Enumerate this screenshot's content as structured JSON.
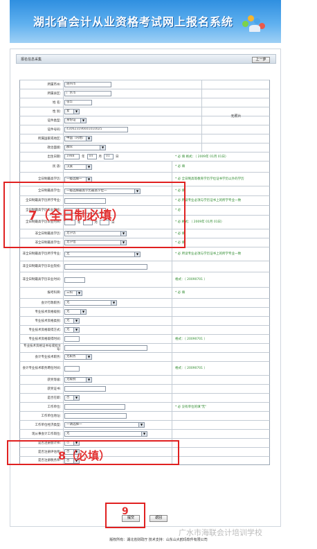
{
  "header": {
    "title": "湖北省会计从业资格考试网上报名系统"
  },
  "infobar": {
    "label": "报名信息采集",
    "back_button": "上一步"
  },
  "photo_label": "无照片",
  "form": {
    "rows": [
      {
        "label": "所属市州:",
        "value": "随州市"
      },
      {
        "label": "所属县区:",
        "value": "广水市"
      },
      {
        "label": "姓    名:",
        "value": "张华"
      },
      {
        "label": "性    别:",
        "value": "女"
      },
      {
        "label": "证件类型:",
        "value": "身份证"
      },
      {
        "label": "证件号码:",
        "value": "430623196601010025"
      },
      {
        "label": "所属国家或地区:",
        "value": "中国（内地）"
      },
      {
        "label": "政治面貌:",
        "value": "群众"
      },
      {
        "label": "出生日期:",
        "value": "1988",
        "month": "04",
        "day": "01",
        "year_unit": "年",
        "month_unit": "月",
        "day_unit": "日",
        "note": "* 必 填   格式：（ 2009年 01月 01日）"
      },
      {
        "label": "民    族:",
        "value": "汉族",
        "note": "* 必 填"
      },
      {
        "label": "全日制最高学历:",
        "value": "一级选择一",
        "note": "* 必    全日制高等教育学历学位证书学历以外的学历"
      },
      {
        "label": "全日制最高学位:",
        "value": "一级选择最高学历最高学位一",
        "note": "* 必 填"
      },
      {
        "label": "全日制最高学历所学专业:",
        "value": "",
        "note": "* 必    所读专业必须与学历证书上的所学专业一致"
      },
      {
        "label": "全日制最高学历毕业院校:",
        "value": "",
        "note": "* 必"
      },
      {
        "label": "全日制最高学历毕业时间:",
        "value": "",
        "year_unit": "年",
        "month_unit": "月",
        "day_unit": "日",
        "note": "* 必    格式：（ 2009年 01月 01日）"
      },
      {
        "label": "非全日制最高学历:",
        "value": "无学历",
        "note": "* 必 填"
      },
      {
        "label": "非全日制最高学位:",
        "value": "无学位",
        "note": "* 必 填"
      },
      {
        "label": "非全日制最高学历所学专业:",
        "value": "无",
        "note": "* 必    所读专业必须与学历证书上的所学专业一致"
      },
      {
        "label": "非全日制最高学历毕业院校:",
        "value": ""
      },
      {
        "label": "非全日制最高学历毕业时间:",
        "value": "",
        "note": "格式：（ 20090701 ）"
      },
      {
        "label": "报考科目:",
        "value": "三科",
        "note": "* 必 填"
      },
      {
        "label": "会计行政职务:",
        "value": "无"
      },
      {
        "label": "专业技术资格级别:",
        "value": "无"
      },
      {
        "label": "专业技术资格类别:",
        "value": "无"
      },
      {
        "label": "专业技术资格取得方式:",
        "value": "无"
      },
      {
        "label": "专业技术资格取得时间:",
        "value": "",
        "note": "格式：（ 20090701 ）"
      },
      {
        "label": "专业技术资格证书号或批文号:",
        "value": ""
      },
      {
        "label": "会计专业技术职务:",
        "value": "无职务"
      },
      {
        "label": "会计专业技术职务聘任时间:",
        "value": "",
        "note": "格式：（ 20090701 ）"
      },
      {
        "label": "获奖等级:",
        "value": "无级别"
      },
      {
        "label": "获奖证书:",
        "value": ""
      },
      {
        "label": "是否在职:",
        "value": "否"
      },
      {
        "label": "工作单位:",
        "value": "",
        "note": "* 必    没有单位的填\"无\""
      },
      {
        "label": "工作单位地址:",
        "value": ""
      },
      {
        "label": "工作单位经济类型:",
        "value": "一请选择一"
      },
      {
        "label": "现从事会计工作岗位:",
        "value": "无"
      },
      {
        "label": "是否注册会计师:",
        "value": "否"
      },
      {
        "label": "是否注册评估师:",
        "value": "否"
      },
      {
        "label": "是否注册税务师:",
        "value": "否"
      }
    ]
  },
  "annotations": {
    "a7": "7（全日制必填）",
    "a8": "8（必填）",
    "a9": "9"
  },
  "buttons": {
    "submit": "提交",
    "back": "返回"
  },
  "footer": "版权所有：湖北省财政厅    技术支持：山东山大鸥玛软件有限公司",
  "watermark": "广水市海联会计培训学校",
  "colors": {
    "banner": "#3f99e6",
    "annotation": "#e02020",
    "note": "#2e8b2e"
  }
}
